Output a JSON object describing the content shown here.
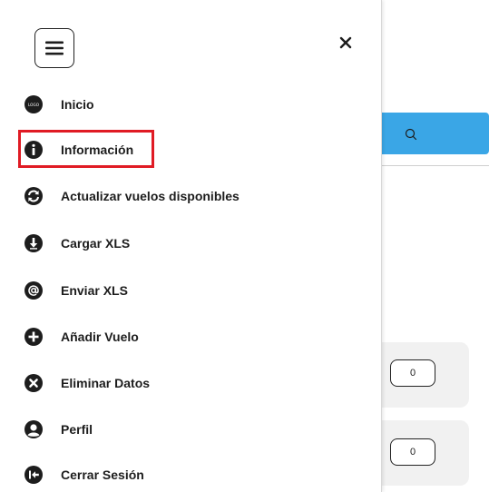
{
  "drawer": {
    "items": [
      {
        "label": "Inicio",
        "icon": "logo-icon"
      },
      {
        "label": "Información",
        "icon": "info-icon"
      },
      {
        "label": "Actualizar vuelos disponibles",
        "icon": "refresh-icon"
      },
      {
        "label": "Cargar XLS",
        "icon": "download-icon"
      },
      {
        "label": "Enviar XLS",
        "icon": "at-icon"
      },
      {
        "label": "Añadir Vuelo",
        "icon": "plus-icon"
      },
      {
        "label": "Eliminar Datos",
        "icon": "remove-icon"
      },
      {
        "label": "Perfil",
        "icon": "user-icon"
      },
      {
        "label": "Cerrar Sesión",
        "icon": "logout-icon"
      }
    ],
    "logo_text": "LOGO",
    "highlighted_item": "Información"
  },
  "background": {
    "quantities": [
      "0",
      "0"
    ]
  },
  "colors": {
    "search_bar": "#3aa6e6",
    "highlight": "#e01b24",
    "icon": "#1d1d1d"
  }
}
